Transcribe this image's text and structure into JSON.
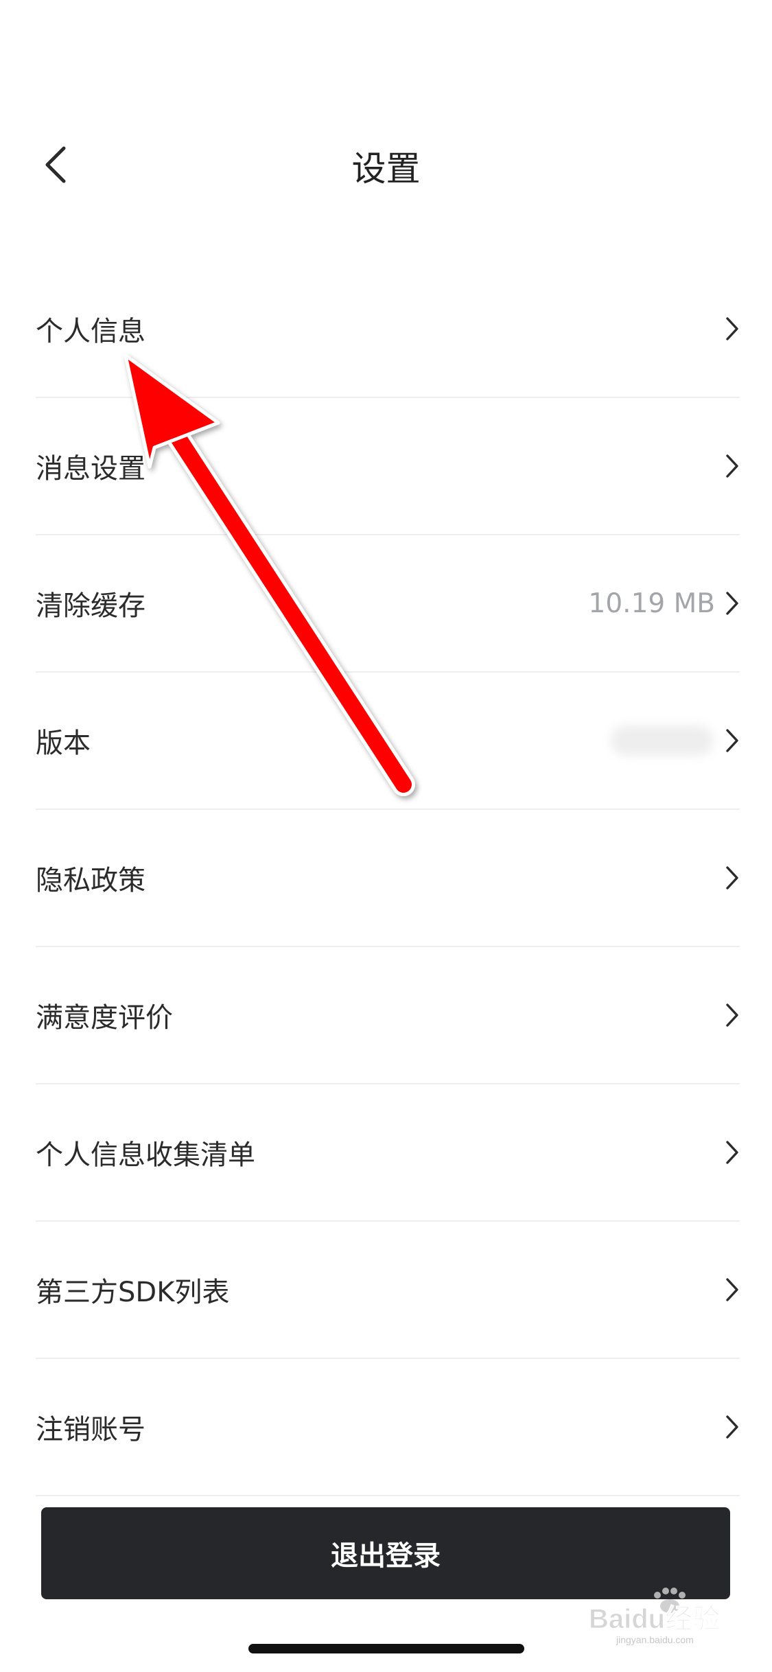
{
  "header": {
    "title": "设置"
  },
  "settings": {
    "items": [
      {
        "label": "个人信息",
        "value": ""
      },
      {
        "label": "消息设置",
        "value": ""
      },
      {
        "label": "清除缓存",
        "value": "10.19 MB"
      },
      {
        "label": "版本",
        "value": ""
      },
      {
        "label": "隐私政策",
        "value": ""
      },
      {
        "label": "满意度评价",
        "value": ""
      },
      {
        "label": "个人信息收集清单",
        "value": ""
      },
      {
        "label": "第三方SDK列表",
        "value": ""
      },
      {
        "label": "注销账号",
        "value": ""
      }
    ]
  },
  "footer": {
    "logout_label": "退出登录"
  },
  "colors": {
    "button_bg": "#25272b",
    "value_text": "#a3a5ab",
    "annotation_arrow": "#ff0000"
  },
  "icons": {
    "back": "back-chevron-icon",
    "row": "chevron-right-icon"
  },
  "watermark": {
    "brand_text": "Baidu经验",
    "site_text": "jingyan.baidu.com"
  }
}
